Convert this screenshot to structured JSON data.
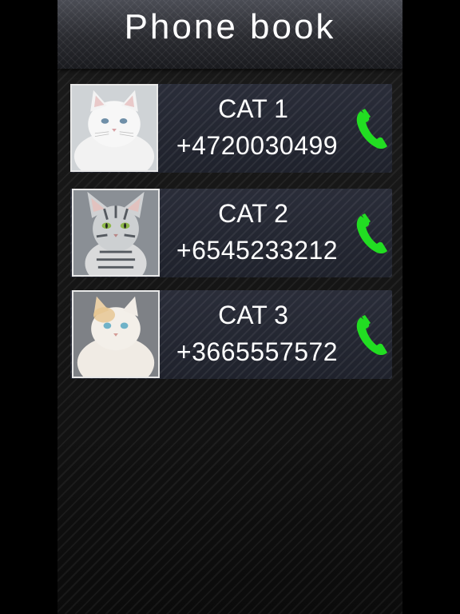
{
  "header": {
    "title": "Phone book"
  },
  "contacts": [
    {
      "name": "CAT 1",
      "phone": "+4720030499",
      "avatar_icon": "white-cat-photo",
      "call_icon": "phone-handset-icon"
    },
    {
      "name": "CAT 2",
      "phone": "+6545233212",
      "avatar_icon": "tabby-cat-photo",
      "call_icon": "phone-handset-icon"
    },
    {
      "name": "CAT 3",
      "phone": "+3665557572",
      "avatar_icon": "cream-cat-photo",
      "call_icon": "phone-handset-icon"
    }
  ],
  "colors": {
    "call_green": "#22dd22",
    "text": "#ffffff",
    "row_bg": "#242733"
  }
}
